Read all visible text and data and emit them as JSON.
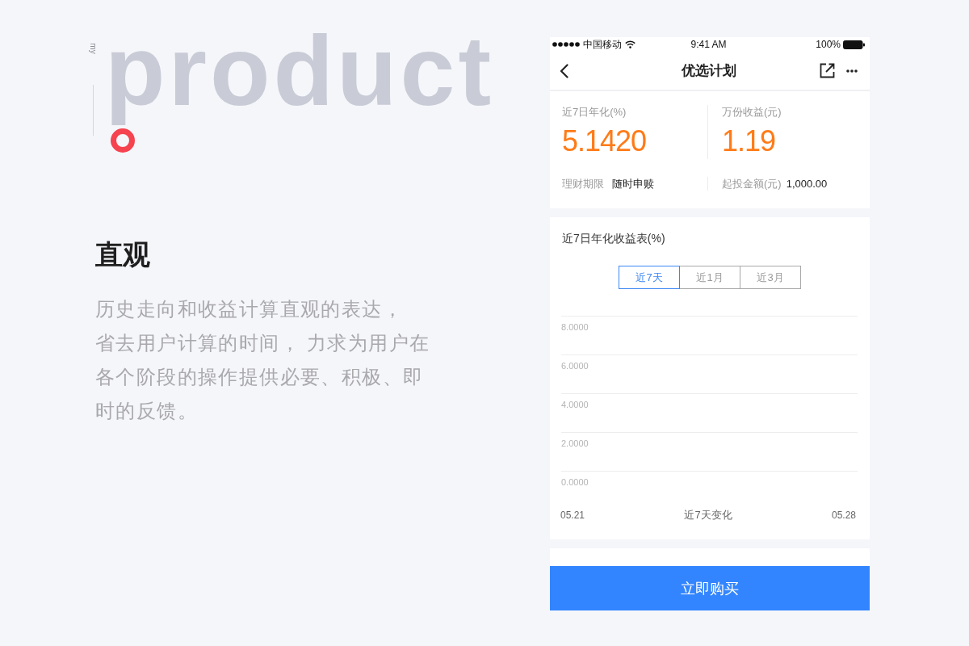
{
  "brand": {
    "tag": "my",
    "word": "product"
  },
  "feature": {
    "title": "直观",
    "description": [
      "历史走向和收益计算直观的表达，",
      "省去用户计算的时间， 力求为用户在各个阶段的操作提供必要、积极、即时的反馈。"
    ]
  },
  "phone": {
    "status_bar": {
      "carrier": "中国移动",
      "time": "9:41 AM",
      "battery": "100%"
    },
    "nav": {
      "title": "优选计划"
    },
    "summary": {
      "stats": [
        {
          "label": "近7日年化(%)",
          "value": "5.1420"
        },
        {
          "label": "万份收益(元)",
          "value": "1.19"
        }
      ],
      "terms": [
        {
          "label": "理财期限",
          "value": "随时申赎"
        },
        {
          "label": "起投金额(元)",
          "value": "1,000.00"
        }
      ]
    },
    "chart_card": {
      "title": "近7日年化收益表(%)",
      "ranges": [
        {
          "label": "近7天",
          "selected": true
        },
        {
          "label": "近1月",
          "selected": false
        },
        {
          "label": "近3月",
          "selected": false
        }
      ],
      "y_axis_labels": [
        "8.0000",
        "6.0000",
        "4.0000",
        "2.0000",
        "0.0000"
      ],
      "x_start": "05.21",
      "x_caption": "近7天变化",
      "x_end": "05.28"
    },
    "buy_button": "立即购买"
  }
}
